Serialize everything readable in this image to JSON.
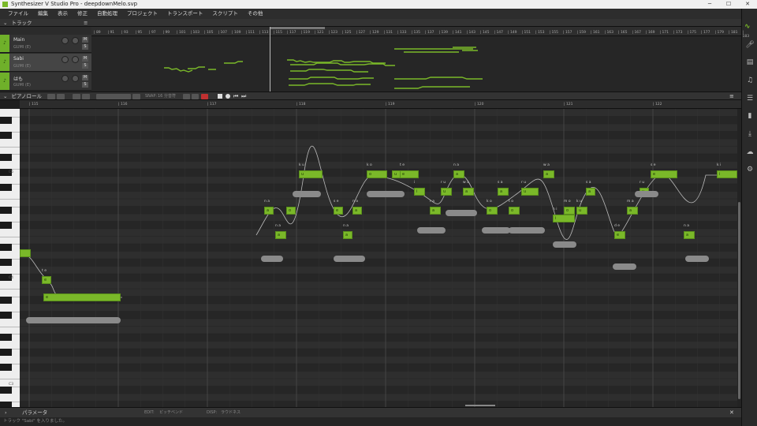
{
  "window": {
    "title": "Synthesizer V Studio Pro - deepdownMelo.svp",
    "minimize": "─",
    "maximize": "☐",
    "close": "✕"
  },
  "menu": [
    "ファイル",
    "編集",
    "表示",
    "修正",
    "自動処理",
    "プロジェクト",
    "トランスポート",
    "スクリプト",
    "その他"
  ],
  "track_panel": {
    "title": "トラック",
    "tracks": [
      {
        "name": "Main",
        "voice": "GUMI (E)",
        "mute": "M",
        "solo": "S",
        "pan_l": "L",
        "pan_r": "R"
      },
      {
        "name": "Sabi",
        "voice": "GUMI (E)",
        "mute": "M",
        "solo": "S",
        "pan_l": "L",
        "pan_r": "R"
      },
      {
        "name": "はも",
        "voice": "GUMI (E)",
        "mute": "M",
        "solo": "S",
        "pan_l": "L",
        "pan_r": "R"
      }
    ],
    "bars": [
      "89",
      "91",
      "93",
      "95",
      "97",
      "99",
      "101",
      "103",
      "105",
      "107",
      "109",
      "111",
      "113",
      "115",
      "117",
      "119",
      "121",
      "123",
      "125",
      "127",
      "129",
      "131",
      "133",
      "135",
      "137",
      "139",
      "141",
      "143",
      "145",
      "147",
      "149",
      "151",
      "153",
      "155",
      "157",
      "159",
      "161",
      "163",
      "165",
      "167",
      "169",
      "171",
      "173",
      "175",
      "177",
      "179",
      "181",
      "183"
    ]
  },
  "piano_roll": {
    "title": "ピアノロール",
    "snap_label": "SNAP:",
    "snap_value": "16 分音符",
    "bars": [
      "115",
      "116",
      "117",
      "118",
      "119",
      "120",
      "121",
      "122"
    ],
    "keys": [
      "C5",
      "C4",
      "C3"
    ]
  },
  "notes": [
    {
      "lyric": "",
      "phon": ""
    },
    {
      "lyric": "e",
      "phon": "t e"
    },
    {
      "lyric": "e",
      "phon": ""
    },
    {
      "lyric": "a",
      "phon": "n a"
    },
    {
      "lyric": "a",
      "phon": "n a"
    },
    {
      "lyric": "o",
      "phon": ""
    },
    {
      "lyric": "u",
      "phon": "k u"
    },
    {
      "lyric": "e",
      "phon": "s e"
    },
    {
      "lyric": "a",
      "phon": "n a"
    },
    {
      "lyric": "a",
      "phon": "n a"
    },
    {
      "lyric": "o",
      "phon": "k o"
    },
    {
      "lyric": "u",
      "phon": ""
    },
    {
      "lyric": "e",
      "phon": "t e"
    },
    {
      "lyric": "i",
      "phon": "i"
    },
    {
      "lyric": "a",
      "phon": "r a"
    },
    {
      "lyric": "u",
      "phon": "r u"
    },
    {
      "lyric": "a",
      "phon": "n a"
    },
    {
      "lyric": "a",
      "phon": "w a"
    },
    {
      "lyric": "o",
      "phon": "k o"
    },
    {
      "lyric": "a",
      "phon": "s a"
    },
    {
      "lyric": "o",
      "phon": "t o"
    },
    {
      "lyric": "u",
      "phon": "r u"
    },
    {
      "lyric": "a",
      "phon": "w a"
    },
    {
      "lyric": "i",
      "phon": "n i"
    },
    {
      "lyric": "o",
      "phon": "m o"
    },
    {
      "lyric": "u",
      "phon": "k u"
    },
    {
      "lyric": "a",
      "phon": "s a"
    },
    {
      "lyric": "e",
      "phon": "d e"
    },
    {
      "lyric": "a",
      "phon": "m a"
    },
    {
      "lyric": "u",
      "phon": "r u"
    },
    {
      "lyric": "e",
      "phon": "s e"
    },
    {
      "lyric": "a",
      "phon": "n a"
    },
    {
      "lyric": "i",
      "phon": "k i"
    }
  ],
  "params": {
    "title": "パラメータ",
    "edit_label": "EDIT:",
    "edit_value": "ピッチベンド",
    "disp_label": "DISP:",
    "disp_value": "ラウドネス"
  },
  "status": "トラック \"Sabi\" を入りました。",
  "colors": {
    "accent": "#7ab829",
    "bg": "#1e1e1e"
  }
}
